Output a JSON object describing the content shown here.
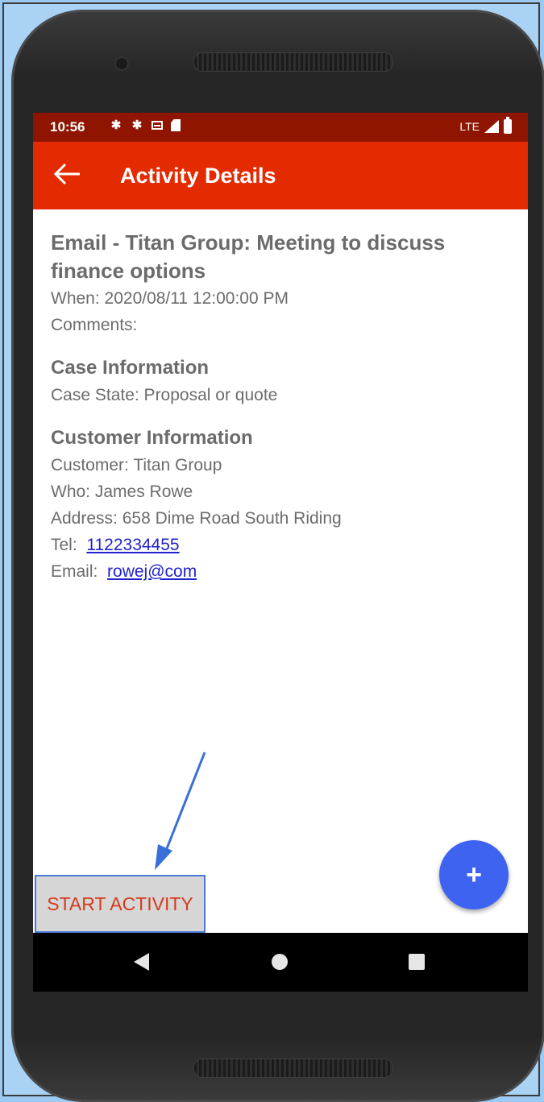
{
  "status_bar": {
    "time": "10:56",
    "network": "LTE",
    "icons": [
      "gear-icon",
      "gear-icon",
      "screen-icon",
      "sd-card-icon",
      "signal-icon",
      "battery-icon"
    ]
  },
  "app_bar": {
    "title": "Activity Details"
  },
  "activity": {
    "headline": "Email - Titan Group: Meeting to discuss finance options",
    "when": "When: 2020/08/11 12:00:00 PM",
    "comments": "Comments:"
  },
  "case_info": {
    "title": "Case Information",
    "state": "Case State: Proposal or quote"
  },
  "customer_info": {
    "title": "Customer Information",
    "customer": "Customer: Titan Group",
    "who": "Who: James Rowe",
    "address": "Address: 658 Dime Road South Riding",
    "tel_label": "Tel:",
    "tel_value": "1122334455",
    "email_label": "Email:",
    "email_value": "rowej@com"
  },
  "actions": {
    "start_activity": "START ACTIVITY",
    "fab_symbol": "+"
  },
  "colors": {
    "status_bar": "#8f1500",
    "app_bar": "#e42a00",
    "fab": "#3f63f1",
    "start_text": "#d43b1d",
    "annotation": "#3a6fd8"
  }
}
